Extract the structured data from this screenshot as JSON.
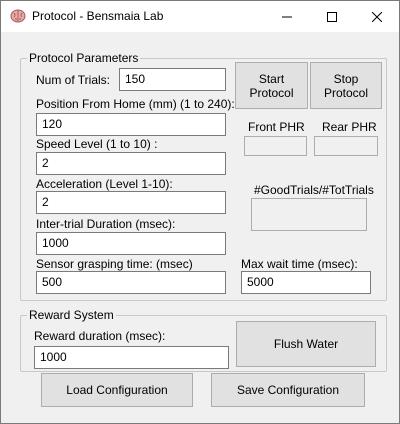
{
  "window": {
    "title": "Protocol - Bensmaia Lab",
    "app_icon": "brain-icon"
  },
  "protocol_parameters": {
    "group_title": "Protocol Parameters",
    "num_trials": {
      "label": "Num of Trials:",
      "value": "150"
    },
    "position_from_home": {
      "label": "Position From Home (mm) (1 to 240):",
      "value": "120"
    },
    "speed_level": {
      "label": "Speed Level (1 to 10) :",
      "value": "2"
    },
    "acceleration": {
      "label": "Acceleration (Level 1-10):",
      "value": "2"
    },
    "inter_trial_duration": {
      "label": "Inter-trial Duration (msec):",
      "value": "1000"
    },
    "sensor_grasping_time": {
      "label": "Sensor grasping time: (msec)",
      "value": "500"
    },
    "max_wait_time": {
      "label": "Max wait time (msec):",
      "value": "5000"
    },
    "start_button": "Start Protocol",
    "stop_button": "Stop Protocol",
    "front_phr_label": "Front PHR",
    "rear_phr_label": "Rear PHR",
    "good_trials_label": "#GoodTrials/#TotTrials"
  },
  "reward_system": {
    "group_title": "Reward System",
    "reward_duration": {
      "label": "Reward duration (msec):",
      "value": "1000"
    },
    "flush_button": "Flush Water"
  },
  "footer": {
    "load_button": "Load Configuration",
    "save_button": "Save Configuration"
  }
}
